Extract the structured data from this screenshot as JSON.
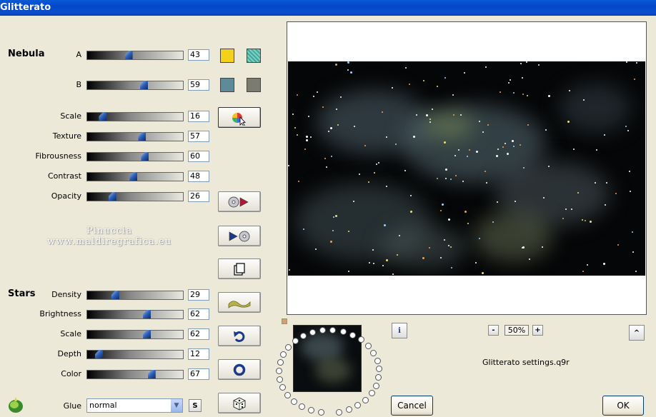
{
  "window": {
    "title": "Glitterato"
  },
  "nebula": {
    "title": "Nebula",
    "sliders": [
      {
        "label": "A",
        "value": "43",
        "pct": 0.43
      },
      {
        "label": "B",
        "value": "59",
        "pct": 0.59
      },
      {
        "label": "Scale",
        "value": "16",
        "pct": 0.16
      },
      {
        "label": "Texture",
        "value": "57",
        "pct": 0.57
      },
      {
        "label": "Fibrousness",
        "value": "60",
        "pct": 0.6
      },
      {
        "label": "Contrast",
        "value": "48",
        "pct": 0.48
      },
      {
        "label": "Opacity",
        "value": "26",
        "pct": 0.26
      }
    ],
    "swatches": {
      "a_primary": "#f5d21a",
      "a_secondary": "#3ea89a",
      "b_primary": "#5f8a99",
      "b_secondary": "#7b7b70"
    }
  },
  "stars": {
    "title": "Stars",
    "sliders": [
      {
        "label": "Density",
        "value": "29",
        "pct": 0.29
      },
      {
        "label": "Brightness",
        "value": "62",
        "pct": 0.62
      },
      {
        "label": "Scale",
        "value": "62",
        "pct": 0.62
      },
      {
        "label": "Depth",
        "value": "12",
        "pct": 0.12
      },
      {
        "label": "Color",
        "value": "67",
        "pct": 0.67
      }
    ]
  },
  "glue": {
    "label": "Glue",
    "value": "normal",
    "s_button": "S"
  },
  "watermark": {
    "line1": "Pinuccia",
    "line2": "www.maldiregrafica.eu"
  },
  "zoom": {
    "minus": "-",
    "value": "50%",
    "plus": "+"
  },
  "info_button": "i",
  "collapse_button": "^",
  "settings_file": "Glitterato settings.q9r",
  "buttons": {
    "cancel": "Cancel",
    "ok": "OK"
  }
}
